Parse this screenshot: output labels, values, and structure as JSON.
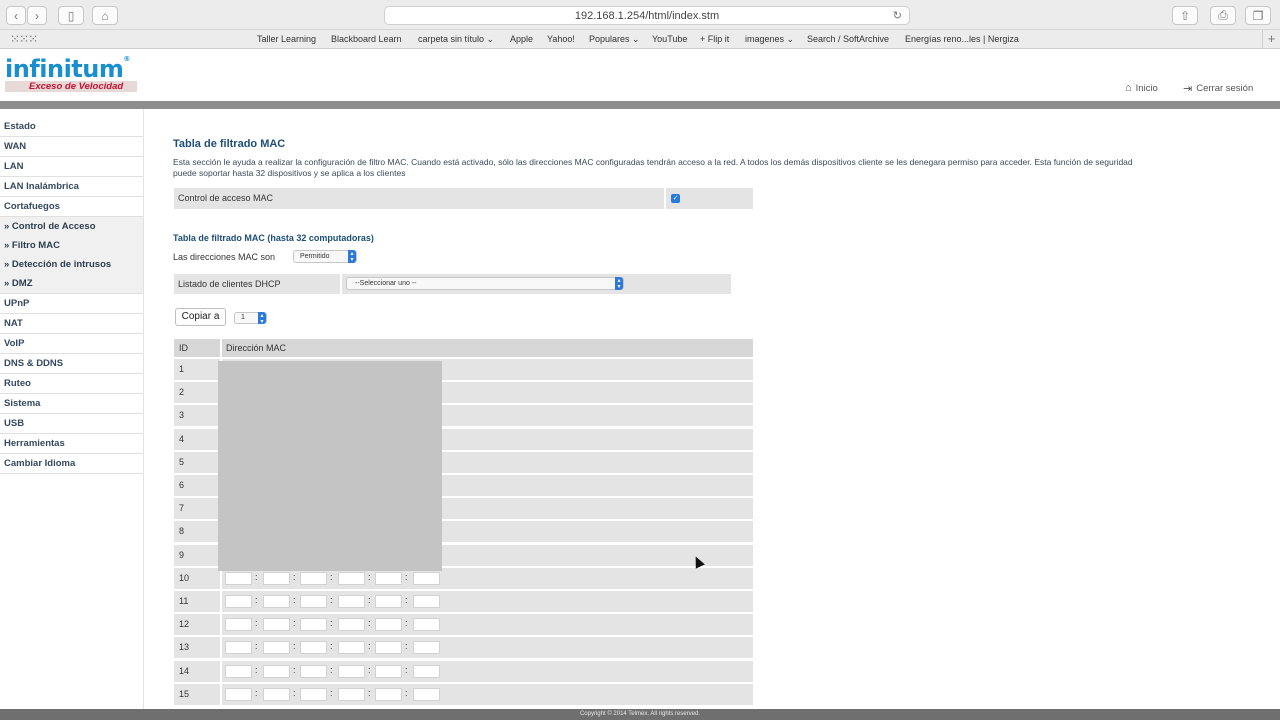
{
  "browser": {
    "url": "192.168.1.254/html/index.stm",
    "bookmarks": [
      {
        "label": "Taller Learning"
      },
      {
        "label": "Blackboard Learn"
      },
      {
        "label": "carpeta sin título ⌄"
      },
      {
        "label": "Apple"
      },
      {
        "label": "Yahoo!"
      },
      {
        "label": "Populares ⌄"
      },
      {
        "label": "YouTube"
      },
      {
        "label": "+ Flip it"
      },
      {
        "label": "imagenes ⌄"
      },
      {
        "label": "Search / SoftArchive"
      },
      {
        "label": "Energías reno...les | Nergiza"
      }
    ]
  },
  "header": {
    "logo_text": "infinitum",
    "logo_tagline": "Exceso de Velocidad",
    "home_label": "Inicio",
    "logout_label": "Cerrar sesión"
  },
  "sidebar": {
    "items": [
      {
        "label": "Estado"
      },
      {
        "label": "WAN"
      },
      {
        "label": "LAN"
      },
      {
        "label": "LAN Inalámbrica"
      },
      {
        "label": "Cortafuegos"
      },
      {
        "label": "» Control de Acceso"
      },
      {
        "label": "» Filtro MAC"
      },
      {
        "label": "» Detección de intrusos"
      },
      {
        "label": "» DMZ"
      },
      {
        "label": "UPnP"
      },
      {
        "label": "NAT"
      },
      {
        "label": "VoIP"
      },
      {
        "label": "DNS & DDNS"
      },
      {
        "label": "Ruteo"
      },
      {
        "label": "Sistema"
      },
      {
        "label": "USB"
      },
      {
        "label": "Herramientas"
      },
      {
        "label": "Cambiar Idioma"
      }
    ]
  },
  "main": {
    "title": "Tabla de filtrado MAC",
    "description": "Esta sección le ayuda a realizar la configuración de filtro MAC. Cuando está activado, sólo las direcciones MAC configuradas tendrán acceso a la red. A todos los demás dispositivos cliente se les denegara permiso para acceder. Esta función de seguridad puede soportar hasta 32 dispositivos y se aplica a los clientes",
    "mac_access_label": "Control de acceso MAC",
    "mac_access_checked": true,
    "subtitle": "Tabla de filtrado MAC (hasta 32 computadoras)",
    "mac_mode_label": "Las direcciones MAC son",
    "mac_mode_value": "Permitido",
    "dhcp_label": "Listado de clientes DHCP",
    "dhcp_value": "--Seleccionar uno --",
    "copy_button": "Copiar a",
    "copy_target": "1",
    "table_headers": {
      "id": "ID",
      "mac": "Dirección MAC"
    },
    "rows": [
      "1",
      "2",
      "3",
      "4",
      "5",
      "6",
      "7",
      "8",
      "9",
      "10",
      "11",
      "12",
      "13",
      "14",
      "15"
    ]
  },
  "footer": {
    "copyright": "Copyright © 2014 Telmex. All rights reserved."
  }
}
